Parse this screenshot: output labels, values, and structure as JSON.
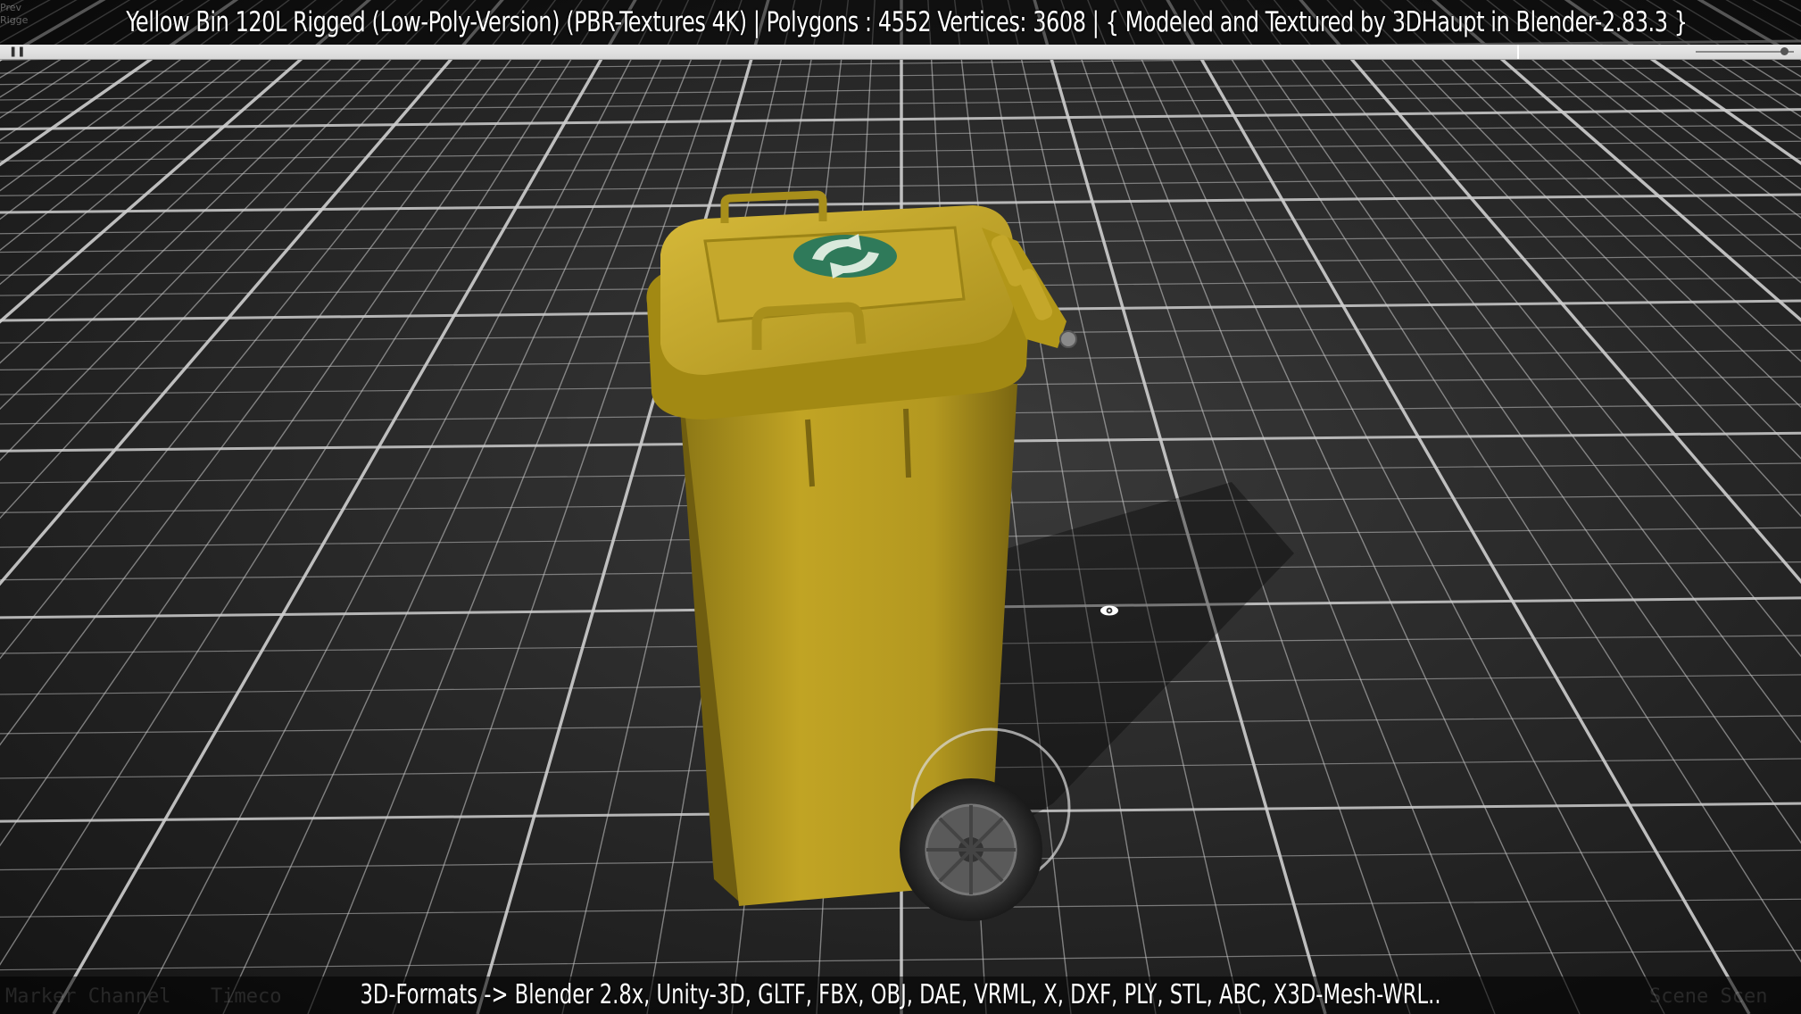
{
  "title": "Yellow Bin 120L Rigged (Low-Poly-Version)  (PBR-Textures 4K) | Polygons : 4552  Vertices: 3608  |  { Modeled and Textured by 3DHaupt in Blender-2.83.3 }",
  "corner_label": "Prev Rigge",
  "formats": "3D-Formats -> Blender 2.8x, Unity-3D, GLTF, FBX, OBJ, DAE, VRML, X, DXF, PLY, STL, ABC, X3D-Mesh-WRL..",
  "timeline": {
    "pause_icon": "pause-icon",
    "zoom_level": 0.9
  },
  "ghost_labels": {
    "left_a": "Marker  Channel",
    "left_b": "Timeco",
    "right": "Scene  Scen"
  },
  "icons": {
    "view_toggle": "eye-icon"
  },
  "colors": {
    "bin_body": "#b59a1f",
    "bin_lid": "#c8ab2a",
    "recycle_badge": "#2f7a5a",
    "floor": "#2e2e2e",
    "grid": "#d0d0d0"
  }
}
